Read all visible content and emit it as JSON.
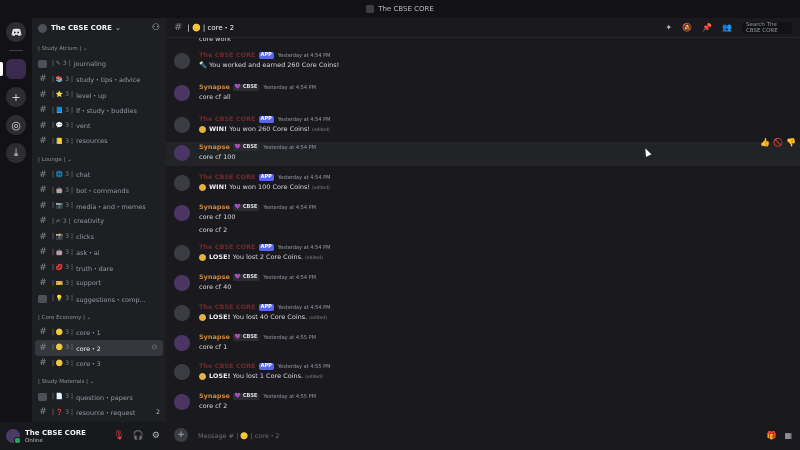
{
  "titlebar": {
    "title": "The CBSE CORE"
  },
  "rail": {
    "icons": [
      "discord-icon",
      "server-icon",
      "add-server-icon",
      "explore-icon",
      "download-icon"
    ]
  },
  "server": {
    "name": "The CBSE CORE"
  },
  "sidebar": {
    "categories": [
      {
        "label": "Study Atrium",
        "channels": [
          {
            "name": "journaling",
            "prefix": "| ✎ 3 |",
            "type": "text-locked"
          },
          {
            "name": "study・tips・advice",
            "prefix": "| 📚 3 |",
            "type": "text"
          },
          {
            "name": "level・up",
            "prefix": "| ⭐ 3 |",
            "type": "text"
          },
          {
            "name": "lf・study・buddies",
            "prefix": "| 📘 3 |",
            "type": "text"
          },
          {
            "name": "vent",
            "prefix": "| 💬 3 |",
            "type": "text"
          },
          {
            "name": "resources",
            "prefix": "| 📒 3 |",
            "type": "text"
          }
        ]
      },
      {
        "label": "Lounge",
        "channels": [
          {
            "name": "chat",
            "prefix": "| 🌐 3 |",
            "type": "text"
          },
          {
            "name": "bot・commands",
            "prefix": "| 🤖 3 |",
            "type": "text"
          },
          {
            "name": "media・and・memes",
            "prefix": "| 📷 3 |",
            "type": "text"
          },
          {
            "name": "creativity",
            "prefix": "| ✍ 3 |",
            "type": "text"
          },
          {
            "name": "clicks",
            "prefix": "| 📸 3 |",
            "type": "text"
          },
          {
            "name": "ask・ai",
            "prefix": "| 🤖 3 |",
            "type": "text"
          },
          {
            "name": "truth・dare",
            "prefix": "| 💋 3 |",
            "type": "text"
          },
          {
            "name": "support",
            "prefix": "| 🎫 3 |",
            "type": "text"
          },
          {
            "name": "suggestions・comp...",
            "prefix": "| 💡 3 |",
            "type": "text-locked"
          }
        ]
      },
      {
        "label": "Core Economy",
        "channels": [
          {
            "name": "core・1",
            "prefix": "| 🪙 3 |",
            "type": "text"
          },
          {
            "name": "core・2",
            "prefix": "| 🪙 3 |",
            "type": "text",
            "active": true
          },
          {
            "name": "core・3",
            "prefix": "| 🪙 3 |",
            "type": "text"
          }
        ]
      },
      {
        "label": "Study Materials",
        "channels": [
          {
            "name": "question・papers",
            "prefix": "| 📄 3 |",
            "type": "text-locked"
          },
          {
            "name": "resource・request",
            "prefix": "| ❓ 3 |",
            "type": "text",
            "badge": "2"
          }
        ]
      }
    ]
  },
  "user": {
    "name": "The CBSE CORE",
    "status": "Online"
  },
  "header": {
    "channel": "| 🪙 | core・2",
    "search_placeholder": "Search The CBSE CORE"
  },
  "messages": [
    {
      "author": "",
      "tag": "",
      "time": "",
      "lines": [
        "core work"
      ],
      "type": "cont"
    },
    {
      "author": "The CBSE CORE",
      "tag": "APP",
      "time": "Yesterday at 4:54 PM",
      "lines": [
        "🔦 You worked and earned 260 Core Coins!"
      ],
      "type": "bot"
    },
    {
      "author": "Synapse",
      "tag": "💜 CBSE",
      "time": "Yesterday at 4:54 PM",
      "lines": [
        "core cf all"
      ],
      "type": "syn"
    },
    {
      "author": "The CBSE CORE",
      "tag": "APP",
      "time": "Yesterday at 4:54 PM",
      "lines": [
        "WIN! You won 260 Core Coins!"
      ],
      "edited": "(edited)",
      "type": "bot"
    },
    {
      "author": "Synapse",
      "tag": "💜 CBSE",
      "time": "Yesterday at 4:54 PM",
      "lines": [
        "core cf 100"
      ],
      "type": "syn"
    },
    {
      "author": "The CBSE CORE",
      "tag": "APP",
      "time": "Yesterday at 4:54 PM",
      "lines": [
        "WIN! You won 100 Core Coins!"
      ],
      "edited": "(edited)",
      "type": "bot"
    },
    {
      "author": "Synapse",
      "tag": "💜 CBSE",
      "time": "Yesterday at 4:54 PM",
      "lines": [
        "core cf 100",
        "core cf 2"
      ],
      "type": "syn"
    },
    {
      "author": "The CBSE CORE",
      "tag": "APP",
      "time": "Yesterday at 4:54 PM",
      "lines": [
        "LOSE! You lost 2 Core Coins."
      ],
      "edited": "(edited)",
      "type": "bot"
    },
    {
      "author": "Synapse",
      "tag": "💜 CBSE",
      "time": "Yesterday at 4:54 PM",
      "lines": [
        "core cf 40"
      ],
      "type": "syn"
    },
    {
      "author": "The CBSE CORE",
      "tag": "APP",
      "time": "Yesterday at 4:54 PM",
      "lines": [
        "LOSE! You lost 40 Core Coins."
      ],
      "edited": "(edited)",
      "type": "bot"
    },
    {
      "author": "Synapse",
      "tag": "💜 CBSE",
      "time": "Yesterday at 4:55 PM",
      "lines": [
        "core cf 1"
      ],
      "type": "syn"
    },
    {
      "author": "The CBSE CORE",
      "tag": "APP",
      "time": "Yesterday at 4:55 PM",
      "lines": [
        "LOSE! You lost 1 Core Coins."
      ],
      "edited": "(edited)",
      "type": "bot"
    },
    {
      "author": "Synapse",
      "tag": "💜 CBSE",
      "time": "Yesterday at 4:55 PM",
      "lines": [
        "core cf 2"
      ],
      "type": "syn"
    }
  ],
  "reactions": [
    "👍",
    "🚫",
    "👎"
  ],
  "composer": {
    "placeholder": "Message # | 🪙 | core・2"
  },
  "colors": {
    "accent": "#5865f2",
    "synapse": "#d28a3c",
    "bot": "#6e2a2a",
    "online": "#23a55a"
  }
}
